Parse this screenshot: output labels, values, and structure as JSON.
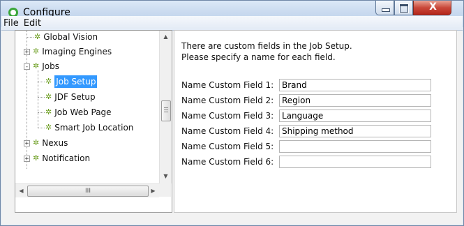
{
  "window": {
    "title": "Configure",
    "close_glyph": "X"
  },
  "menubar": {
    "items": [
      "File",
      "Edit"
    ]
  },
  "tree": {
    "nodes": [
      {
        "label": "Global Vision",
        "icon": "gear-icon"
      },
      {
        "label": "Imaging Engines",
        "icon": "gear-icon",
        "expander": "+"
      },
      {
        "label": "Jobs",
        "icon": "gear-icon",
        "expander": "-"
      },
      {
        "label": "Job Setup",
        "icon": "gear-icon",
        "selected": true
      },
      {
        "label": "JDF Setup",
        "icon": "gear-icon"
      },
      {
        "label": "Job Web Page",
        "icon": "gear-icon"
      },
      {
        "label": "Smart Job Location",
        "icon": "gear-icon"
      },
      {
        "label": "Nexus",
        "icon": "gear-icon",
        "expander": "+"
      },
      {
        "label": "Notification",
        "icon": "gear-icon",
        "expander": "+"
      }
    ],
    "hscroll_label": "III"
  },
  "panel": {
    "intro_line1": "There are custom fields in the Job Setup.",
    "intro_line2": "Please specify a name for each field.",
    "fields": [
      {
        "label": "Name Custom Field 1:",
        "value": "Brand"
      },
      {
        "label": "Name Custom Field 2:",
        "value": "Region"
      },
      {
        "label": "Name Custom Field 3:",
        "value": "Language"
      },
      {
        "label": "Name Custom Field 4:",
        "value": "Shipping method"
      },
      {
        "label": "Name Custom Field 5:",
        "value": ""
      },
      {
        "label": "Name Custom Field 6:",
        "value": ""
      }
    ]
  },
  "colors": {
    "selection": "#3399ff",
    "gear": "#6a9c1e",
    "app_icon": "#3aa63a"
  }
}
